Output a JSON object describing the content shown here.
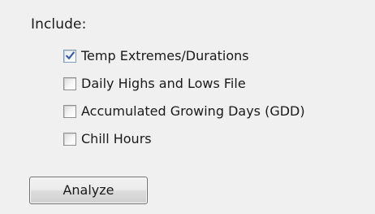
{
  "include_label": "Include:",
  "options": [
    {
      "label": "Temp Extremes/Durations",
      "checked": true
    },
    {
      "label": "Daily Highs and Lows File",
      "checked": false
    },
    {
      "label": "Accumulated Growing Days (GDD)",
      "checked": false
    },
    {
      "label": "Chill Hours",
      "checked": false
    }
  ],
  "analyze_button": {
    "label": "Analyze"
  },
  "colors": {
    "background": "#f0f0f0",
    "checkmark": "#3a5fa0"
  }
}
